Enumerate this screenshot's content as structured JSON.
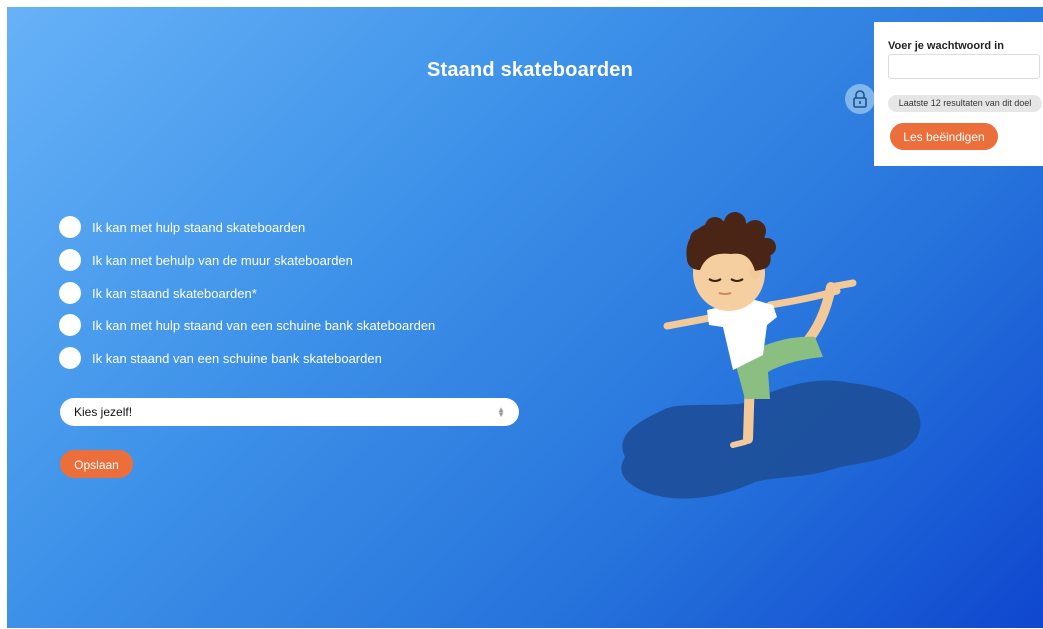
{
  "page": {
    "title": "Staand skateboarden"
  },
  "options": [
    {
      "label": "Ik kan met hulp staand skateboarden"
    },
    {
      "label": "Ik kan met behulp van de muur skateboarden"
    },
    {
      "label": "Ik kan staand skateboarden*"
    },
    {
      "label": "Ik kan met hulp staand van een schuine bank skateboarden"
    },
    {
      "label": "Ik kan staand van een schuine bank skateboarden"
    }
  ],
  "select": {
    "value": "Kies jezelf!"
  },
  "save_button": {
    "label": "Opslaan"
  },
  "password_panel": {
    "label": "Voer je wachtwoord in",
    "input_value": "",
    "results_label": "Laatste 12 resultaten van dit doel",
    "end_button_label": "Les beëindigen"
  },
  "icons": {
    "lock": "lock-icon",
    "select_arrows": "updown-arrows-icon"
  },
  "colors": {
    "accent": "#ec6e3b",
    "gradient_start": "#67b2f8",
    "gradient_end": "#0f47cf"
  }
}
